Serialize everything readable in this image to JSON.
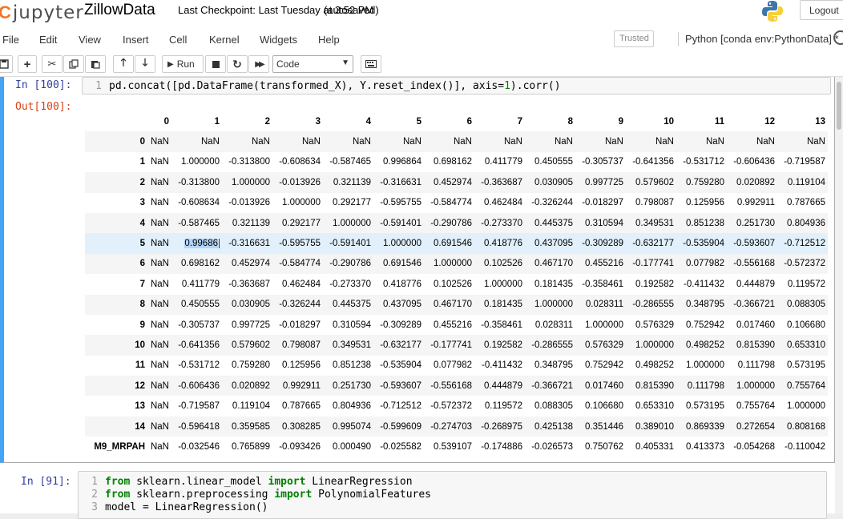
{
  "header": {
    "logo_text": "jupyter",
    "notebook_name": "ZillowData",
    "checkpoint": "Last Checkpoint: Last Tuesday at 3:52 PM",
    "autosave": "(autosaved)",
    "logout_label": "Logout"
  },
  "menubar": {
    "items": [
      "File",
      "Edit",
      "View",
      "Insert",
      "Cell",
      "Kernel",
      "Widgets",
      "Help"
    ],
    "trusted_label": "Trusted",
    "kernel_name": "Python [conda env:PythonData] *"
  },
  "toolbar": {
    "run_label": "Run",
    "cell_type": "Code"
  },
  "cell_100": {
    "in_prompt": "In [100]:",
    "out_prompt": "Out[100]:",
    "line_no": "1",
    "code_pre": "pd.concat([pd.DataFrame(transformed_X), Y.reset_index()], axis=",
    "code_num": "1",
    "code_post": ").corr()"
  },
  "dataframe": {
    "columns": [
      "",
      "0",
      "1",
      "2",
      "3",
      "4",
      "5",
      "6",
      "7",
      "8",
      "9",
      "10",
      "11",
      "12",
      "13"
    ],
    "rows": [
      [
        "0",
        "NaN",
        "NaN",
        "NaN",
        "NaN",
        "NaN",
        "NaN",
        "NaN",
        "NaN",
        "NaN",
        "NaN",
        "NaN",
        "NaN",
        "NaN",
        "NaN"
      ],
      [
        "1",
        "NaN",
        "1.000000",
        "-0.313800",
        "-0.608634",
        "-0.587465",
        "0.996864",
        "0.698162",
        "0.411779",
        "0.450555",
        "-0.305737",
        "-0.641356",
        "-0.531712",
        "-0.606436",
        "-0.719587"
      ],
      [
        "2",
        "NaN",
        "-0.313800",
        "1.000000",
        "-0.013926",
        "0.321139",
        "-0.316631",
        "0.452974",
        "-0.363687",
        "0.030905",
        "0.997725",
        "0.579602",
        "0.759280",
        "0.020892",
        "0.119104"
      ],
      [
        "3",
        "NaN",
        "-0.608634",
        "-0.013926",
        "1.000000",
        "0.292177",
        "-0.595755",
        "-0.584774",
        "0.462484",
        "-0.326244",
        "-0.018297",
        "0.798087",
        "0.125956",
        "0.992911",
        "0.787665"
      ],
      [
        "4",
        "NaN",
        "-0.587465",
        "0.321139",
        "0.292177",
        "1.000000",
        "-0.591401",
        "-0.290786",
        "-0.273370",
        "0.445375",
        "0.310594",
        "0.349531",
        "0.851238",
        "0.251730",
        "0.804936"
      ],
      [
        "5",
        "NaN",
        "0.996864",
        "-0.316631",
        "-0.595755",
        "-0.591401",
        "1.000000",
        "0.691546",
        "0.418776",
        "0.437095",
        "-0.309289",
        "-0.632177",
        "-0.535904",
        "-0.593607",
        "-0.712512"
      ],
      [
        "6",
        "NaN",
        "0.698162",
        "0.452974",
        "-0.584774",
        "-0.290786",
        "0.691546",
        "1.000000",
        "0.102526",
        "0.467170",
        "0.455216",
        "-0.177741",
        "0.077982",
        "-0.556168",
        "-0.572372"
      ],
      [
        "7",
        "NaN",
        "0.411779",
        "-0.363687",
        "0.462484",
        "-0.273370",
        "0.418776",
        "0.102526",
        "1.000000",
        "0.181435",
        "-0.358461",
        "0.192582",
        "-0.411432",
        "0.444879",
        "0.119572"
      ],
      [
        "8",
        "NaN",
        "0.450555",
        "0.030905",
        "-0.326244",
        "0.445375",
        "0.437095",
        "0.467170",
        "0.181435",
        "1.000000",
        "0.028311",
        "-0.286555",
        "0.348795",
        "-0.366721",
        "0.088305"
      ],
      [
        "9",
        "NaN",
        "-0.305737",
        "0.997725",
        "-0.018297",
        "0.310594",
        "-0.309289",
        "0.455216",
        "-0.358461",
        "0.028311",
        "1.000000",
        "0.576329",
        "0.752942",
        "0.017460",
        "0.106680"
      ],
      [
        "10",
        "NaN",
        "-0.641356",
        "0.579602",
        "0.798087",
        "0.349531",
        "-0.632177",
        "-0.177741",
        "0.192582",
        "-0.286555",
        "0.576329",
        "1.000000",
        "0.498252",
        "0.815390",
        "0.653310"
      ],
      [
        "11",
        "NaN",
        "-0.531712",
        "0.759280",
        "0.125956",
        "0.851238",
        "-0.535904",
        "0.077982",
        "-0.411432",
        "0.348795",
        "0.752942",
        "0.498252",
        "1.000000",
        "0.111798",
        "0.573195"
      ],
      [
        "12",
        "NaN",
        "-0.606436",
        "0.020892",
        "0.992911",
        "0.251730",
        "-0.593607",
        "-0.556168",
        "0.444879",
        "-0.366721",
        "0.017460",
        "0.815390",
        "0.111798",
        "1.000000",
        "0.755764"
      ],
      [
        "13",
        "NaN",
        "-0.719587",
        "0.119104",
        "0.787665",
        "0.804936",
        "-0.712512",
        "-0.572372",
        "0.119572",
        "0.088305",
        "0.106680",
        "0.653310",
        "0.573195",
        "0.755764",
        "1.000000"
      ],
      [
        "14",
        "NaN",
        "-0.596418",
        "0.359585",
        "0.308285",
        "0.995074",
        "-0.599609",
        "-0.274703",
        "-0.268975",
        "0.425138",
        "0.351446",
        "0.389010",
        "0.869339",
        "0.272654",
        "0.808168"
      ],
      [
        "M9_MRPAH",
        "NaN",
        "-0.032546",
        "0.765899",
        "-0.093426",
        "0.000490",
        "-0.025582",
        "0.539107",
        "-0.174886",
        "-0.026573",
        "0.750762",
        "0.405331",
        "0.413373",
        "-0.054268",
        "-0.110042"
      ]
    ],
    "highlight_row_label": "5",
    "selected_text": "0.99686"
  },
  "cell_91": {
    "in_prompt": "In [91]:",
    "lines": [
      {
        "no": "1",
        "kw1": "from",
        "mod": " sklearn.linear_model ",
        "kw2": "import",
        "name": " LinearRegression"
      },
      {
        "no": "2",
        "kw1": "from",
        "mod": " sklearn.preprocessing ",
        "kw2": "import",
        "name": " PolynomialFeatures"
      },
      {
        "no": "3",
        "plain": "model = LinearRegression()"
      }
    ]
  },
  "colors": {
    "accent": "#f37626",
    "selected_cell_border": "#42a5f5",
    "in_prompt": "#303f9f",
    "out_prompt": "#d84315",
    "keyword": "#008000"
  },
  "icons": {
    "save": "floppy-icon",
    "add": "plus-icon",
    "cut": "scissors-icon",
    "copy": "copy-icon",
    "paste": "paste-icon",
    "move_up": "arrow-up-icon",
    "move_down": "arrow-down-icon",
    "run": "play-icon",
    "interrupt": "stop-icon",
    "restart": "restart-icon",
    "restart_run_all": "fast-forward-icon",
    "command_palette": "keyboard-icon"
  }
}
